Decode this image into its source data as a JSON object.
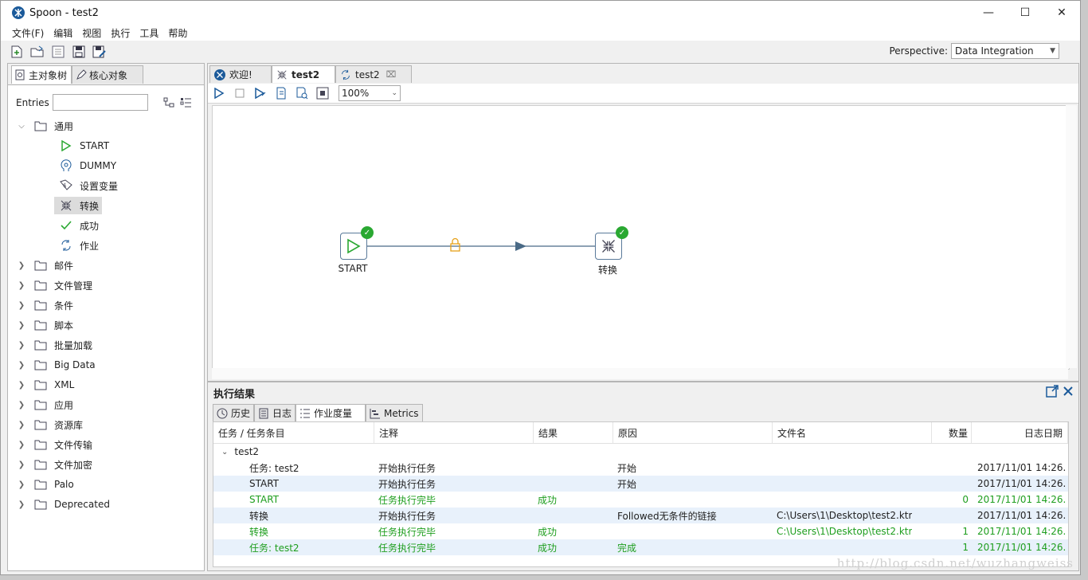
{
  "window": {
    "title": "Spoon - test2"
  },
  "menu": [
    "文件(F)",
    "编辑",
    "视图",
    "执行",
    "工具",
    "帮助"
  ],
  "perspective": {
    "label": "Perspective:",
    "value": "Data Integration"
  },
  "left": {
    "tabs": [
      "主对象树",
      "核心对象"
    ],
    "entries_label": "Entries",
    "entries_value": "",
    "general": {
      "label": "通用",
      "items": [
        "START",
        "DUMMY",
        "设置变量",
        "转换",
        "成功",
        "作业"
      ]
    },
    "folders": [
      "邮件",
      "文件管理",
      "条件",
      "脚本",
      "批量加载",
      "Big Data",
      "XML",
      "应用",
      "资源库",
      "文件传输",
      "文件加密",
      "Palo",
      "Deprecated"
    ]
  },
  "editor": {
    "tabs": [
      "欢迎!",
      "test2",
      "test2"
    ],
    "zoom": "100%",
    "nodes": {
      "start": "START",
      "trans": "转换"
    }
  },
  "results": {
    "title": "执行结果",
    "tabs": [
      "历史",
      "日志",
      "作业度量",
      "Metrics"
    ],
    "columns": [
      "任务 / 任务条目",
      "注释",
      "结果",
      "原因",
      "文件名",
      "数量",
      "日志日期"
    ],
    "group": "test2",
    "rows": [
      {
        "c0": "任务: test2",
        "c1": "开始执行任务",
        "c2": "",
        "c3": "开始",
        "c4": "",
        "c5": "",
        "c6": "2017/11/01 14:26..."
      },
      {
        "c0": "START",
        "c1": "开始执行任务",
        "c2": "",
        "c3": "开始",
        "c4": "",
        "c5": "",
        "c6": "2017/11/01 14:26..."
      },
      {
        "c0": "START",
        "c1": "任务执行完毕",
        "c2": "成功",
        "c3": "",
        "c4": "",
        "c5": "0",
        "c6": "2017/11/01 14:26..."
      },
      {
        "c0": "转换",
        "c1": "开始执行任务",
        "c2": "",
        "c3": "Followed无条件的链接",
        "c4": "C:\\Users\\1\\Desktop\\test2.ktr",
        "c5": "",
        "c6": "2017/11/01 14:26..."
      },
      {
        "c0": "转换",
        "c1": "任务执行完毕",
        "c2": "成功",
        "c3": "",
        "c4": "C:\\Users\\1\\Desktop\\test2.ktr",
        "c5": "1",
        "c6": "2017/11/01 14:26..."
      },
      {
        "c0": "任务: test2",
        "c1": "任务执行完毕",
        "c2": "成功",
        "c3": "完成",
        "c4": "",
        "c5": "1",
        "c6": "2017/11/01 14:26..."
      }
    ]
  },
  "watermark": "http://blog.csdn.net/wuzhangweiss"
}
